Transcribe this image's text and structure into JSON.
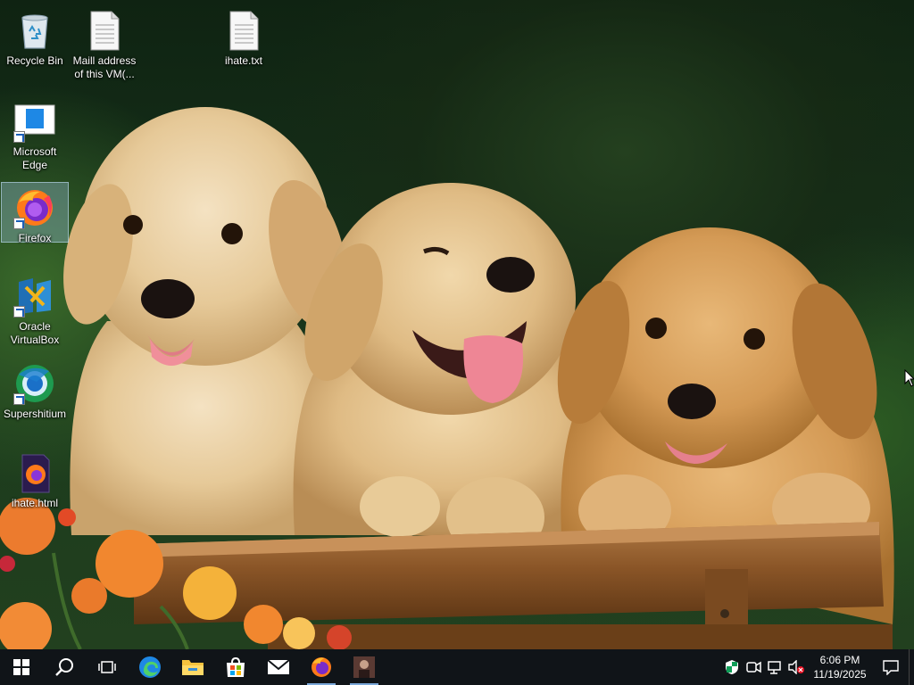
{
  "desktop": {
    "icons": [
      {
        "label": "Recycle Bin",
        "icon": "recycle-bin-icon"
      },
      {
        "label": "Maill address\nof this VM(...",
        "icon": "text-file-icon"
      },
      {
        "label": "ihate.txt",
        "icon": "text-file-icon"
      },
      {
        "label": "Microsoft\nEdge",
        "icon": "edge-icon"
      },
      {
        "label": "Firefox",
        "icon": "firefox-icon",
        "selected": true
      },
      {
        "label": "Oracle\nVirtualBox",
        "icon": "virtualbox-icon"
      },
      {
        "label": "Supershitium",
        "icon": "supershitium-icon"
      },
      {
        "label": "ihate.html",
        "icon": "firefox-html-icon"
      }
    ]
  },
  "taskbar": {
    "items": [
      {
        "name": "start",
        "icon": "windows-logo-icon"
      },
      {
        "name": "search",
        "icon": "search-icon"
      },
      {
        "name": "task-view",
        "icon": "task-view-icon"
      },
      {
        "name": "edge",
        "icon": "edge-icon"
      },
      {
        "name": "file-explorer",
        "icon": "folder-icon"
      },
      {
        "name": "store",
        "icon": "store-icon"
      },
      {
        "name": "mail",
        "icon": "mail-icon"
      },
      {
        "name": "firefox",
        "icon": "firefox-icon"
      },
      {
        "name": "app",
        "icon": "app-thumbnail-icon"
      }
    ],
    "tray": {
      "icons": [
        "security-shield-icon",
        "meet-now-icon",
        "network-icon",
        "volume-muted-icon"
      ],
      "time": "6:06 PM",
      "date": "11/19/2025"
    }
  },
  "colors": {
    "taskbar_bg": "#101418",
    "accent": "#0078d7"
  }
}
